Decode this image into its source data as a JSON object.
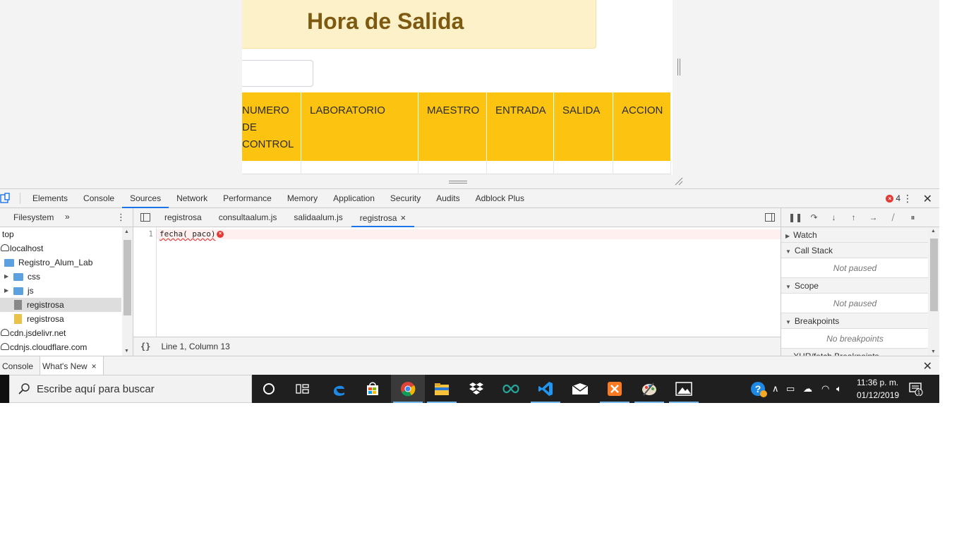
{
  "page": {
    "hero_title": "Hora de Salida",
    "table_headers": [
      [
        "NUMERO",
        "DE",
        "CONTROL"
      ],
      [
        "LABORATORIO"
      ],
      [
        "MAESTRO"
      ],
      [
        "ENTRADA"
      ],
      [
        "SALIDA"
      ],
      [
        "ACCION"
      ]
    ]
  },
  "devtools": {
    "tabs": [
      "Elements",
      "Console",
      "Sources",
      "Network",
      "Performance",
      "Memory",
      "Application",
      "Security",
      "Audits",
      "Adblock Plus"
    ],
    "active_tab": "Sources",
    "error_count": "4",
    "navigator": {
      "tab": "Filesystem",
      "more": "»",
      "tree": [
        {
          "label": "top",
          "type": "frame",
          "depth": 0
        },
        {
          "label": "localhost",
          "type": "cloud",
          "depth": 0
        },
        {
          "label": "Registro_Alum_Lab",
          "type": "folder-open",
          "depth": 1
        },
        {
          "label": "css",
          "type": "folder",
          "depth": 2
        },
        {
          "label": "js",
          "type": "folder",
          "depth": 2
        },
        {
          "label": "registrosa",
          "type": "file-gray",
          "depth": 3,
          "selected": true
        },
        {
          "label": "registrosa",
          "type": "file-yellow",
          "depth": 3
        },
        {
          "label": "cdn.jsdelivr.net",
          "type": "cloud",
          "depth": 0
        },
        {
          "label": "cdnjs.cloudflare.com",
          "type": "cloud",
          "depth": 0
        }
      ]
    },
    "editor": {
      "tabs": [
        "registrosa",
        "consultaalum.js",
        "salidaalum.js",
        "registrosa"
      ],
      "active_tab_index": 3,
      "close_glyph": "×",
      "line_number": "1",
      "code": "fecha( paco)",
      "status": "Line 1, Column 13",
      "pretty_print": "{}"
    },
    "debugger": {
      "sections": [
        {
          "title": "Watch",
          "body": null
        },
        {
          "title": "Call Stack",
          "body": "Not paused"
        },
        {
          "title": "Scope",
          "body": "Not paused"
        },
        {
          "title": "Breakpoints",
          "body": "No breakpoints"
        },
        {
          "title": "XHR/fetch Breakpoints",
          "body": null
        }
      ]
    },
    "drawer": {
      "tabs": [
        "Console",
        "What's New"
      ],
      "active_tab": "What's New"
    }
  },
  "taskbar": {
    "search_placeholder": "Escribe aquí para buscar",
    "time": "11:36 p. m.",
    "date": "01/12/2019",
    "notification_count": "1",
    "apps": [
      "cortana-icon",
      "task-view-icon",
      "edge-icon",
      "store-icon",
      "chrome-icon",
      "file-explorer-icon",
      "dropbox-icon",
      "arduino-icon",
      "vscode-icon",
      "mail-icon",
      "xampp-icon",
      "paint-icon",
      "photos-icon"
    ],
    "colors": {
      "taskbar": "#1f1f1f",
      "accent": "#76b9ed",
      "table_header": "#fcc411",
      "hero_bg": "#fdf1c9",
      "hero_text": "#7d5a10"
    }
  }
}
